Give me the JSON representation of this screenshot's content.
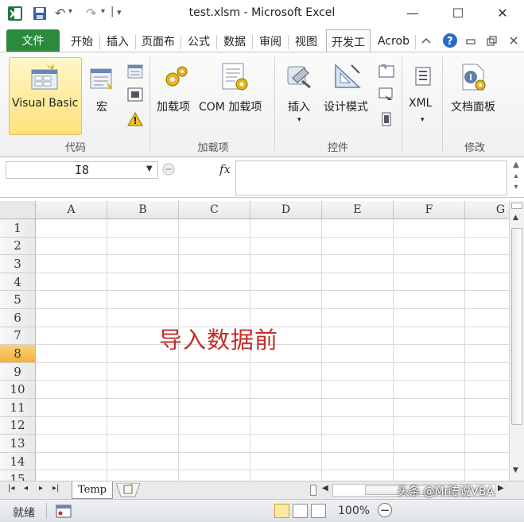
{
  "window": {
    "title": "test.xlsm  -  Microsoft Excel",
    "minimize": "—",
    "maximize": "☐",
    "close": "✕"
  },
  "quick_access": {
    "undo": "↶",
    "redo": "↷",
    "dropdown": "▾",
    "separator": "|"
  },
  "tabs": [
    {
      "label": "文件"
    },
    {
      "label": "开始"
    },
    {
      "label": "插入"
    },
    {
      "label": "页面布"
    },
    {
      "label": "公式"
    },
    {
      "label": "数据"
    },
    {
      "label": "审阅"
    },
    {
      "label": "视图"
    },
    {
      "label": "开发工"
    },
    {
      "label": "Acrob"
    }
  ],
  "ribbon": {
    "groups": {
      "code": "代码",
      "addins": "加载项",
      "controls": "控件",
      "modify": "修改"
    },
    "buttons": {
      "visual_basic": "Visual Basic",
      "macro": "宏",
      "addins": "加载项",
      "com_addins": "COM 加载项",
      "insert": "插入",
      "design_mode": "设计模式",
      "xml": "XML",
      "doc_panel": "文档面板"
    }
  },
  "formula_bar": {
    "name_box": "I8",
    "fx": "fx"
  },
  "grid": {
    "columns": [
      "A",
      "B",
      "C",
      "D",
      "E",
      "F",
      "G"
    ],
    "rows": [
      "1",
      "2",
      "3",
      "4",
      "5",
      "6",
      "7",
      "8",
      "9",
      "10",
      "11",
      "12",
      "13",
      "14",
      "15"
    ],
    "selected_row": "8",
    "overlay_text": "导入数据前"
  },
  "sheets": {
    "active": "Temp",
    "nav": [
      "|◂",
      "◂",
      "▸",
      "▸|"
    ]
  },
  "status": {
    "ready": "就绪",
    "zoom": "100%",
    "zoom_minus": "−"
  },
  "watermark": "头条 @Mr陈说VBA",
  "colors": {
    "file_tab": "#2b8a3e",
    "overlay_text": "#c0302a",
    "selected_row": "#f3b13b"
  }
}
